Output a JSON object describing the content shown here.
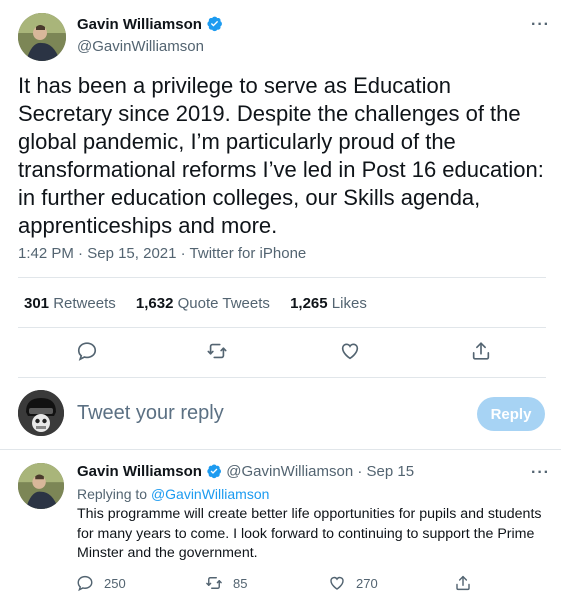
{
  "author": {
    "name": "Gavin Williamson",
    "handle": "@GavinWilliamson"
  },
  "tweet": {
    "text": "It has been a privilege to serve as Education Secretary since 2019. Despite the challenges of the global pandemic, I’m particularly proud of the transformational reforms I’ve led in Post 16 education: in further education colleges, our Skills agenda, apprenticeships and more.",
    "time": "1:42 PM",
    "date": "Sep 15, 2021",
    "source": "Twitter for iPhone",
    "stats": {
      "retweets_count": "301",
      "retweets_label": "Retweets",
      "quotes_count": "1,632",
      "quotes_label": "Quote Tweets",
      "likes_count": "1,265",
      "likes_label": "Likes"
    }
  },
  "compose": {
    "placeholder": "Tweet your reply",
    "reply_label": "Reply"
  },
  "reply_tweet": {
    "name": "Gavin Williamson",
    "handle": "@GavinWilliamson",
    "date": "Sep 15",
    "replying_prefix": "Replying to",
    "replying_to": "@GavinWilliamson",
    "text": "This programme will create better life opportunities for pupils and students for many years to come. I look forward to continuing to support the Prime Minster and the government.",
    "replies": "250",
    "retweets": "85",
    "likes": "270"
  },
  "icons": {
    "verified": "verified-badge-icon",
    "more": "more-icon",
    "reply": "reply-icon",
    "retweet": "retweet-icon",
    "like": "heart-icon",
    "share": "share-icon"
  },
  "colors": {
    "accent": "#1d9bf0",
    "reply_button_disabled": "#a7d3f4",
    "secondary_text": "#536471",
    "divider": "#e1e6ea"
  }
}
